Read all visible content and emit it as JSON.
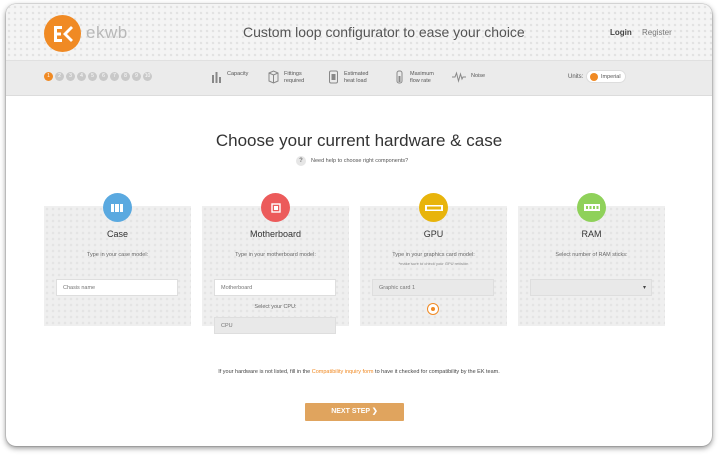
{
  "header": {
    "brand": "ekwb",
    "title": "Custom loop configurator to ease your choice",
    "login": "Login",
    "register": "Register"
  },
  "toolbar": {
    "steps": [
      "1",
      "2",
      "3",
      "4",
      "5",
      "6",
      "7",
      "8",
      "9",
      "10"
    ],
    "active_step": 1,
    "metrics": [
      {
        "icon": "capacity-icon",
        "label": "Capacity"
      },
      {
        "icon": "fittings-icon",
        "label": "Fittings\nrequired"
      },
      {
        "icon": "heat-load-icon",
        "label": "Estimated\nheat load"
      },
      {
        "icon": "flow-rate-icon",
        "label": "Maximum\nflow rate"
      },
      {
        "icon": "noise-icon",
        "label": "Noise"
      }
    ],
    "units_label": "Units:",
    "units_value": "Imperial"
  },
  "main": {
    "title": "Choose your current hardware & case",
    "help_icon": "?",
    "help_text": "Need help to choose right components?"
  },
  "cards": {
    "case": {
      "title": "Case",
      "badge_color": "#5aa9e0",
      "sub": "Type in your case model:",
      "placeholder": "Chasis name"
    },
    "motherboard": {
      "title": "Motherboard",
      "badge_color": "#ec5b5b",
      "sub": "Type in your motherboard model:",
      "placeholder": "Motherboard",
      "cpu_label": "Select your CPU:",
      "cpu_placeholder": "CPU"
    },
    "gpu": {
      "title": "GPU",
      "badge_color": "#e8b40b",
      "sub": "Type in your graphics card model:",
      "note": "*make sure to check your GPU revision",
      "placeholder": "Graphic card 1"
    },
    "ram": {
      "title": "RAM",
      "badge_color": "#8fd15a",
      "sub": "Select number of RAM sticks:",
      "arrow": "▾"
    }
  },
  "footer": {
    "note_before": "If your hardware is not listed, fill in the ",
    "note_link": "Compatibility inquiry form",
    "note_after": " to have it checked for compatibility by the EK team.",
    "next_label": "NEXT STEP ❯"
  }
}
